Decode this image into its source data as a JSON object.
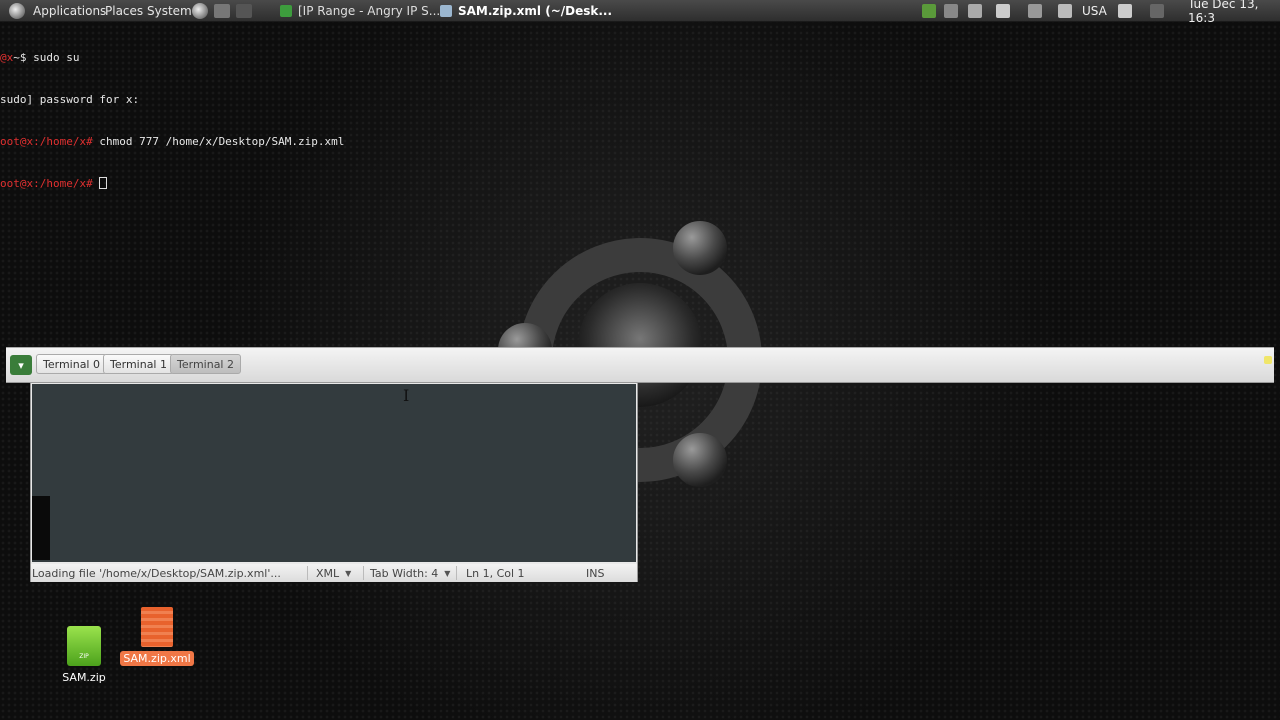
{
  "top_panel": {
    "menus": [
      "Applications",
      "Places",
      "System"
    ],
    "tasks": [
      {
        "label": "[IP Range - Angry IP S...",
        "icon": "angry-ip-scanner-icon",
        "active": false
      },
      {
        "label": "SAM.zip.xml (~/Desk...",
        "icon": "text-editor-icon",
        "active": true
      }
    ],
    "keyboard_layout": "USA",
    "clock": "Tue Dec 13, 16:3"
  },
  "terminal": {
    "lines": [
      {
        "prompt": "@x",
        "text": "~$ sudo su"
      },
      {
        "prompt": "",
        "text": "sudo] password for x:"
      },
      {
        "prompt": "oot@x",
        "path": ":/home/x#",
        "text": " chmod 777 /home/x/Desktop/SAM.zip.xml"
      },
      {
        "prompt": "oot@x",
        "path": ":/home/x#",
        "text": " "
      }
    ]
  },
  "tabbar": {
    "tabs": [
      {
        "label": "Terminal 0",
        "active": false
      },
      {
        "label": "Terminal 1",
        "active": false
      },
      {
        "label": "Terminal 2",
        "active": true
      }
    ]
  },
  "editor": {
    "status_message": "Loading file '/home/x/Desktop/SAM.zip.xml'...",
    "language": "XML",
    "tab_width": "Tab Width:  4",
    "position": "Ln 1, Col 1",
    "mode": "INS"
  },
  "desktop": {
    "icons": [
      {
        "label": "SAM.zip",
        "type": "zip-file-icon",
        "selected": false
      },
      {
        "label": "SAM.zip.xml",
        "type": "xml-file-icon",
        "selected": true
      }
    ]
  },
  "colors": {
    "prompt_red": "#e03030",
    "editor_bg": "#333b3e",
    "selection_orange": "#f07746"
  }
}
